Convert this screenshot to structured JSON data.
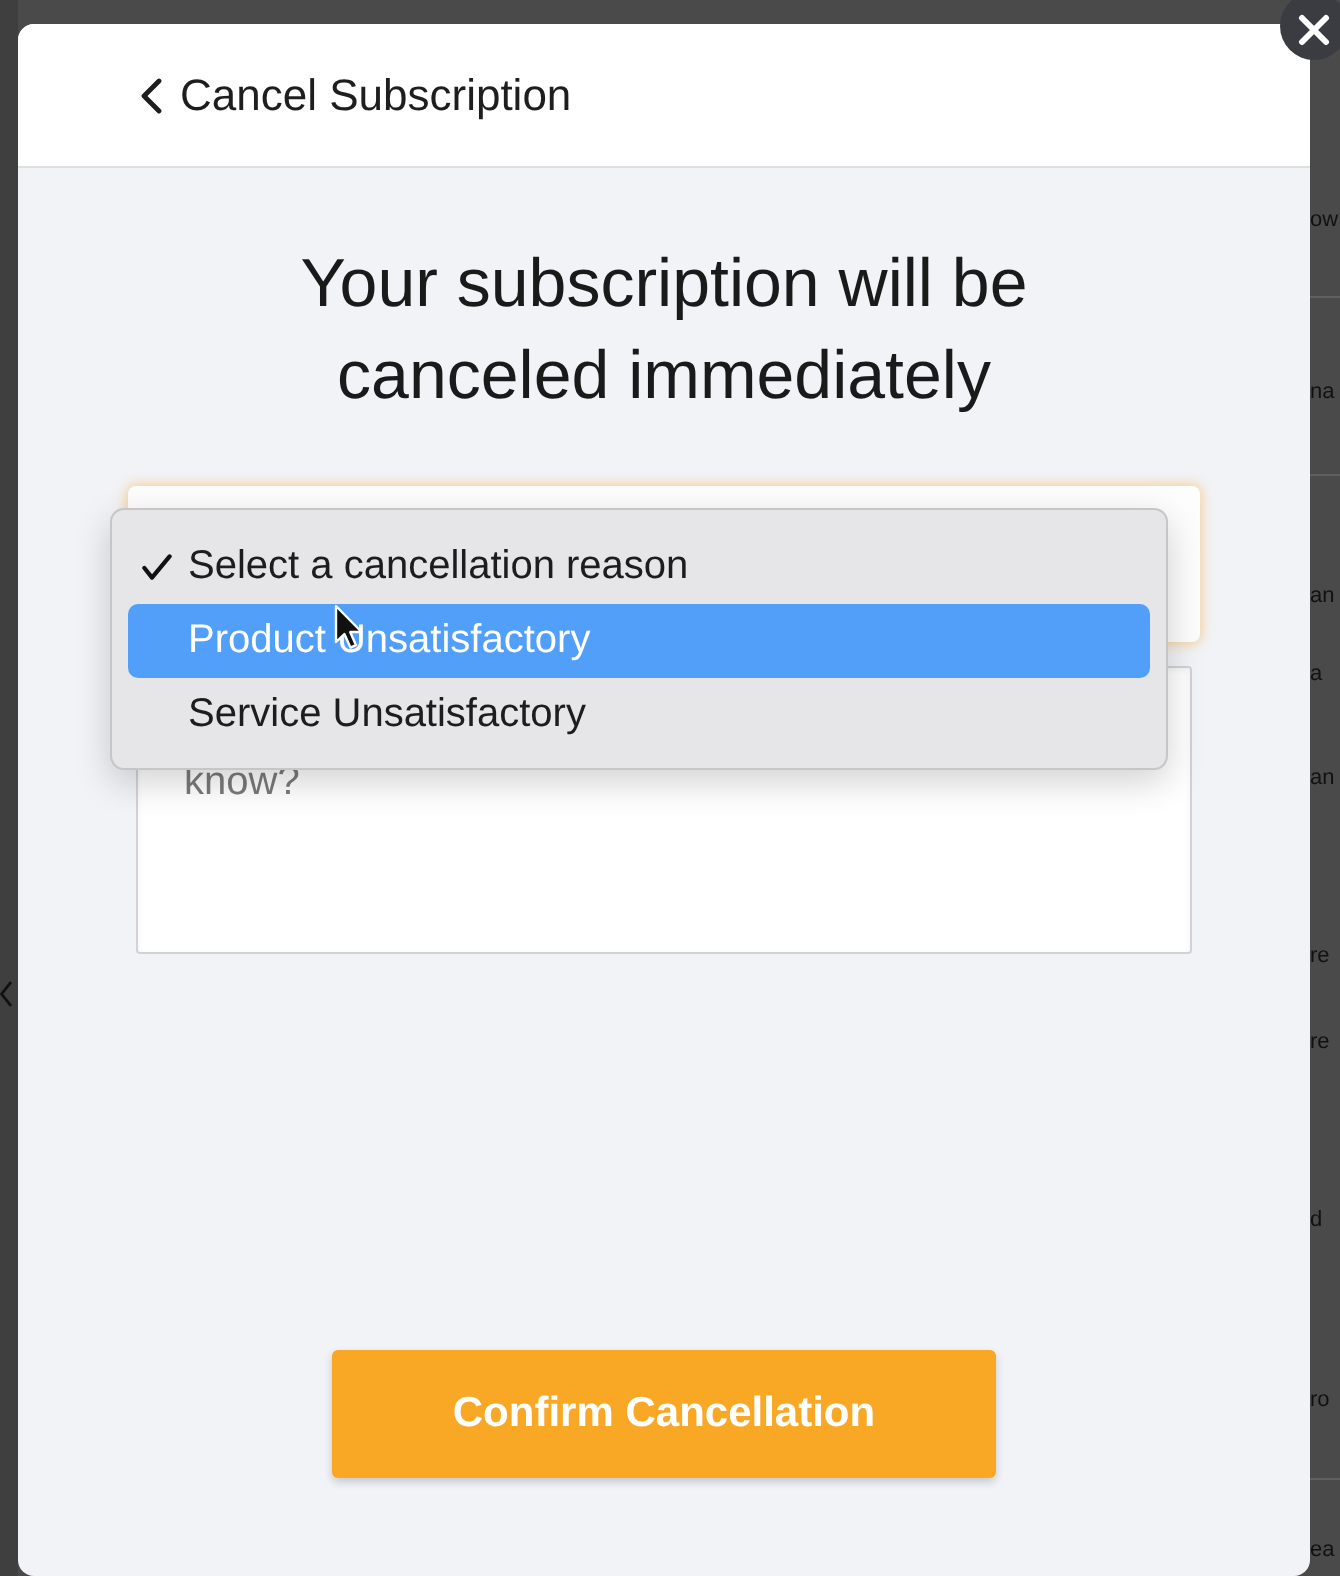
{
  "background_page": {
    "fragments": [
      "ow",
      "na",
      "an",
      "a",
      "an",
      "re",
      "re",
      "d",
      "ro",
      "ea"
    ]
  },
  "modal": {
    "header": {
      "title": "Cancel Subscription"
    },
    "heading": "Your subscription will be canceled immediately",
    "reason_select": {
      "expanded": true,
      "options": [
        {
          "label": "Select a cancellation reason",
          "checked": true,
          "selected": false
        },
        {
          "label": "Product Unsatisfactory",
          "checked": false,
          "selected": true
        },
        {
          "label": "Service Unsatisfactory",
          "checked": false,
          "selected": false
        }
      ]
    },
    "comment_field": {
      "placeholder": "know?"
    },
    "confirm_button": "Confirm Cancellation"
  }
}
